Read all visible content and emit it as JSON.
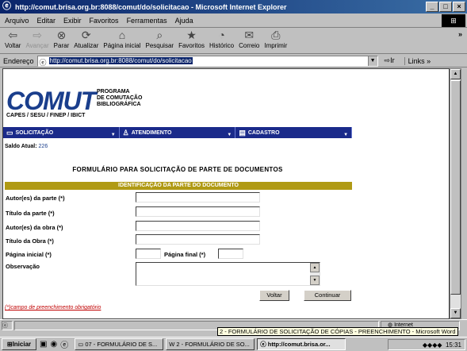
{
  "window": {
    "title": "http://comut.brisa.org.br:8088/comut/do/solicitacao - Microsoft Internet Explorer"
  },
  "menu": [
    "Arquivo",
    "Editar",
    "Exibir",
    "Favoritos",
    "Ferramentas",
    "Ajuda"
  ],
  "toolbar": {
    "back": "Voltar",
    "forward": "Avançar",
    "stop": "Parar",
    "refresh": "Atualizar",
    "home": "Página inicial",
    "search": "Pesquisar",
    "favorites": "Favoritos",
    "history": "Histórico",
    "mail": "Correio",
    "print": "Imprimir"
  },
  "address": {
    "label": "Endereço",
    "url": "http://comut.brisa.org.br:8088/comut/do/solicitacao",
    "go": "Ir",
    "links": "Links"
  },
  "page": {
    "logo": "COMUT",
    "logo_sub": [
      "PROGRAMA",
      "DE COMUTAÇÃO",
      "BIBLIOGRÁFICA"
    ],
    "capes": "CAPES / SESU / FINEP / IBICT",
    "nav": [
      "SOLICITAÇÃO",
      "ATENDIMENTO",
      "CADASTRO"
    ],
    "saldo_label": "Saldo Atual:",
    "saldo_value": "226",
    "form_title": "FORMULÁRIO PARA SOLICITAÇÃO DE PARTE DE DOCUMENTOS",
    "section": "IDENTIFICAÇÃO DA PARTE DO DOCUMENTO",
    "fields": {
      "autores_parte": "Autor(es) da parte (*)",
      "titulo_parte": "Título da parte (*)",
      "autores_obra": "Autor(es) da obra (*)",
      "titulo_obra": "Título da Obra (*)",
      "pagina_inicial": "Página inicial (*)",
      "pagina_final": "Página final (*)",
      "observacao": "Observação"
    },
    "buttons": {
      "voltar": "Voltar",
      "continuar": "Continuar"
    },
    "required_note": "(*)campo de preenchimento obrigatório"
  },
  "status": {
    "zone": "Internet"
  },
  "tooltip": "2 - FORMULÁRIO DE SOLICITAÇÃO DE CÓPIAS - PREENCHIMENTO - Microsoft Word",
  "taskbar": {
    "start": "Iniciar",
    "tasks": [
      "07 - FORMULÁRIO DE S...",
      "2 - FORMULÁRIO DE SO...",
      "http://comut.brisa.or..."
    ],
    "clock": "15:31"
  }
}
